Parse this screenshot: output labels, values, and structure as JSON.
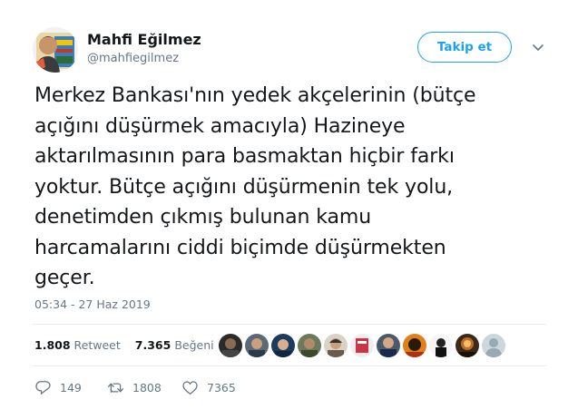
{
  "author": {
    "name": "Mahfi Eğilmez",
    "handle": "@mahfiegilmez"
  },
  "follow_button": {
    "label": "Takip et"
  },
  "tweet": {
    "lines": [
      "Merkez Bankası'nın yedek akçelerinin (bütçe",
      "açığını düşürmek amacıyla) Hazineye",
      "aktarılmasının para basmaktan hiçbir farkı",
      "yoktur. Bütçe açığını düşürmenin tek yolu,",
      "denetimden çıkmış bulunan kamu",
      "harcamalarını ciddi biçimde düşürmekten",
      "geçer."
    ],
    "timestamp": "05:34 - 27 Haz 2019"
  },
  "stats": {
    "retweet_count": "1.808",
    "retweet_label": "Retweet",
    "like_count": "7.365",
    "like_label": "Beğeni"
  },
  "actions": {
    "reply_count": "149",
    "retweet_count": "1808",
    "like_count": "7365"
  },
  "colors": {
    "accent": "#1da1f2",
    "text_primary": "#14171a",
    "text_secondary": "#657786",
    "divider": "#e6ecf0"
  },
  "icons": {
    "caret": "chevron-down-icon",
    "reply": "reply-icon",
    "retweet": "retweet-icon",
    "like": "heart-icon"
  }
}
